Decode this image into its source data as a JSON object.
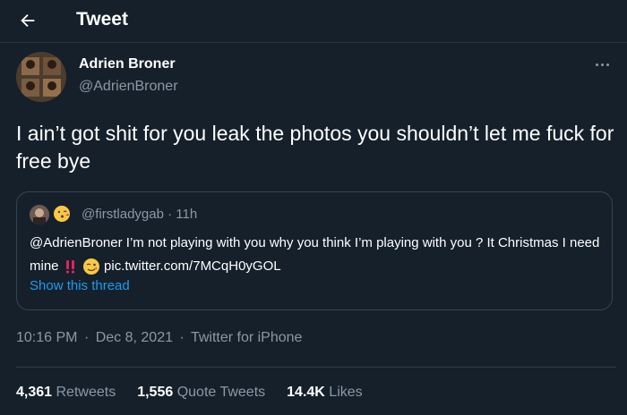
{
  "header": {
    "title": "Tweet"
  },
  "tweet": {
    "display_name": "Adrien Broner",
    "handle": "@AdrienBroner",
    "text": "I ain’t got shit for you leak the photos you shouldn’t let me fuck for free bye",
    "time": "10:16 PM",
    "date": "Dec 8, 2021",
    "source": "Twitter for iPhone",
    "separator": "·"
  },
  "quote": {
    "handle": "@firstladygab",
    "time": "11h",
    "text_part1": "@AdrienBroner  I’m not playing with you why you think I’m playing with you ? It Christmas I need mine",
    "link": "pic.twitter.com/7MCqH0yGOL",
    "show_thread": "Show this thread"
  },
  "stats": {
    "retweets_count": "4,361",
    "retweets_label": "Retweets",
    "quotes_count": "1,556",
    "quotes_label": "Quote Tweets",
    "likes_count": "14.4K",
    "likes_label": "Likes"
  },
  "colors": {
    "background": "#15202b",
    "secondary_text": "#8b98a5",
    "accent": "#1d9bf0",
    "border": "#38444d"
  },
  "icons": [
    "back-arrow-icon",
    "more-icon",
    "double-exclamation-emoji",
    "winking-face-emoji",
    "kissing-face-emoji"
  ]
}
